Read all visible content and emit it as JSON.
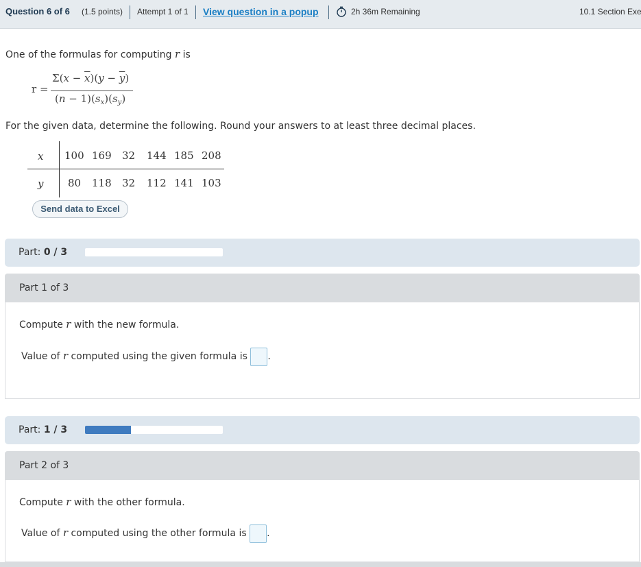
{
  "header": {
    "question": "Question 6 of 6",
    "points": "(1.5 points)",
    "attempt": "Attempt 1 of 1",
    "popup_link": "View question in a popup",
    "remaining": "2h 36m Remaining",
    "section": "10.1 Section Exe",
    "timer_icon": "stopwatch-icon"
  },
  "intro": {
    "line1": "One of the formulas for computing",
    "line1_var": "r",
    "line1_end": "is",
    "instructions": "For the given data, determine the following. Round your answers to at least three decimal places."
  },
  "formula": {
    "lhs": "r =",
    "numerator": "Σ(x − x̄)(y − ȳ)",
    "denominator": "(n − 1)(sx)(sy)"
  },
  "data_table": {
    "x_label": "x",
    "y_label": "y",
    "x_values": [
      "100",
      "169",
      "32",
      "144",
      "185",
      "208"
    ],
    "y_values": [
      "80",
      "118",
      "32",
      "112",
      "141",
      "103"
    ]
  },
  "excel_button": "Send data to Excel",
  "parts": [
    {
      "progress_label": "Part:",
      "progress_value": "0 / 3",
      "progress_fraction": 0,
      "title": "Part 1 of 3",
      "prompt_start": "Compute",
      "prompt_var": "r",
      "prompt_end": "with the new formula.",
      "answer_start": "Value of",
      "answer_var": "r",
      "answer_end": "computed using the given formula is",
      "answer_suffix": "."
    },
    {
      "progress_label": "Part:",
      "progress_value": "1 / 3",
      "progress_fraction": 0.333,
      "title": "Part 2 of 3",
      "prompt_start": "Compute",
      "prompt_var": "r",
      "prompt_end": "with the other formula.",
      "answer_start": "Value of",
      "answer_var": "r",
      "answer_end": "computed using the other formula is",
      "answer_suffix": "."
    }
  ]
}
